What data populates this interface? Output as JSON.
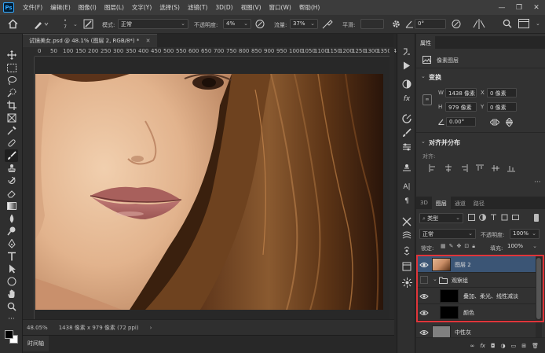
{
  "menubar": {
    "logo": "Ps",
    "items": [
      "文件(F)",
      "编辑(E)",
      "图像(I)",
      "图层(L)",
      "文字(Y)",
      "选择(S)",
      "滤镜(T)",
      "3D(D)",
      "视图(V)",
      "窗口(W)",
      "帮助(H)"
    ]
  },
  "options": {
    "mode_label": "模式:",
    "mode_value": "正常",
    "opacity_label": "不透明度:",
    "opacity_value": "4%",
    "flow_label": "流量:",
    "flow_value": "37%",
    "smooth_label": "平滑:",
    "angle_value": "0°"
  },
  "document": {
    "tab_title": "试镜美女.psd @ 48.1% (图层 2, RGB/8*) *",
    "ruler_ticks": [
      "0",
      "50",
      "100",
      "150",
      "200",
      "250",
      "300",
      "350",
      "400",
      "450",
      "500",
      "550",
      "600",
      "650",
      "700",
      "750",
      "800",
      "850",
      "900",
      "950",
      "1000",
      "1050",
      "1100",
      "1150",
      "1200",
      "1250",
      "1300",
      "1350",
      "1400"
    ],
    "zoom": "48.05%",
    "doc_info": "1438 像素 x 979 像素 (72 ppi)",
    "timeline_label": "时间轴"
  },
  "properties": {
    "tab": "属性",
    "type_label": "像素图层",
    "transform_title": "变换",
    "w_label": "W",
    "w_value": "1438 像素",
    "h_label": "H",
    "h_value": "979 像素",
    "x_label": "X",
    "x_value": "0 像素",
    "y_label": "Y",
    "y_value": "0 像素",
    "angle_value": "0.00°",
    "align_title": "对齐并分布",
    "align_label": "对齐:"
  },
  "layers_panel": {
    "tabs": [
      "3D",
      "图层",
      "通道",
      "路径"
    ],
    "filter_value": "类型",
    "blend_mode": "正常",
    "opacity_label": "不透明度:",
    "opacity_value": "100%",
    "lock_label": "锁定:",
    "fill_label": "填充:",
    "fill_value": "100%",
    "layers": [
      {
        "name": "图层 2",
        "selected": true
      },
      {
        "name": "观察组"
      },
      {
        "name": "叠加、柔光、线性减淡"
      },
      {
        "name": "颜色"
      },
      {
        "name": "中性灰"
      }
    ]
  },
  "colors": {
    "highlight_box": "#e0353a",
    "selection": "#3b5575",
    "ps_blue": "#31a8ff"
  }
}
